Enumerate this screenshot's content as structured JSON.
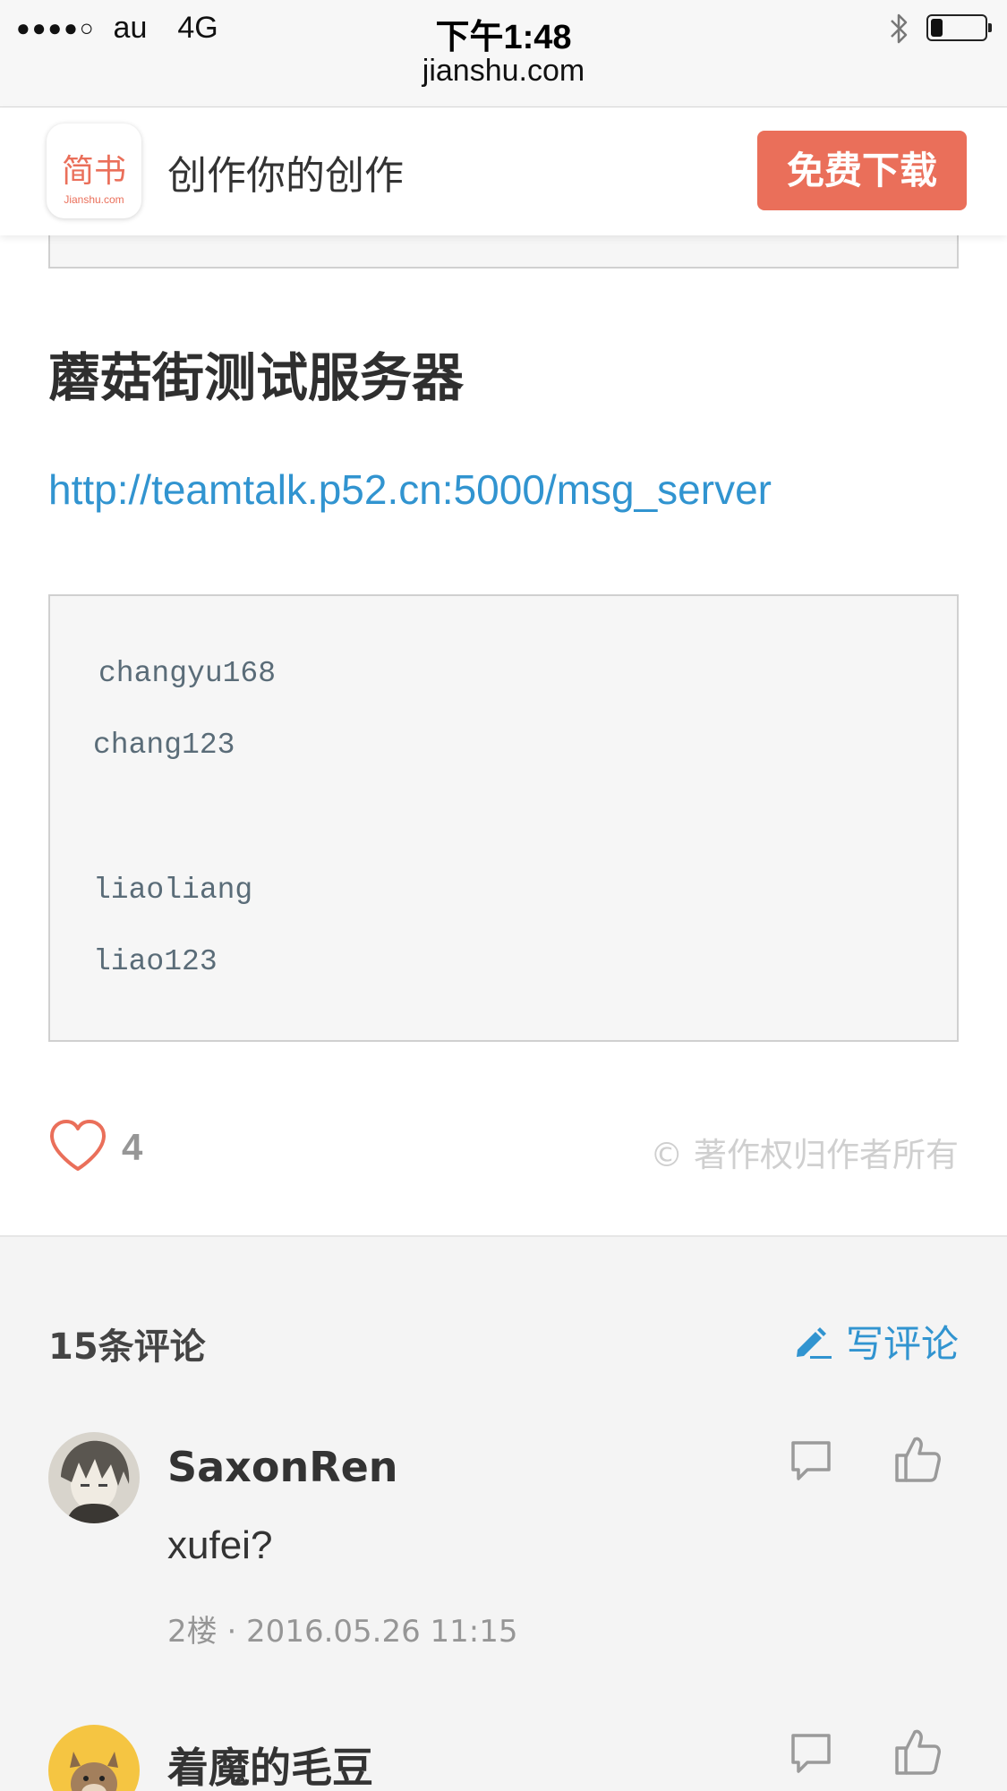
{
  "status_bar": {
    "signal": "●●●●○",
    "carrier": "au",
    "network": "4G",
    "time": "下午1:48",
    "url": "jianshu.com",
    "battery_level": 0.22
  },
  "banner": {
    "logo_text": "简书",
    "logo_subtext": "Jianshu.com",
    "slogan": "创作你的创作",
    "download_label": "免费下载"
  },
  "article": {
    "heading": "蘑菇街测试服务器",
    "link": "http://teamtalk.p52.cn:5000/msg_server",
    "code_lines": [
      "changyu168",
      "chang123",
      "liaoliang",
      "liao123"
    ],
    "like_count": "4",
    "copyright": "© 著作权归作者所有"
  },
  "comments": {
    "count_label": "15条评论",
    "write_label": "写评论",
    "items": [
      {
        "author": "SaxonRen",
        "text": "xufei?",
        "meta": "2楼 · 2016.05.26 11:15"
      },
      {
        "author": "着魔的毛豆",
        "text": "",
        "meta": ""
      }
    ]
  },
  "colors": {
    "brand": "#ea6f5a",
    "link": "#3194d0"
  }
}
